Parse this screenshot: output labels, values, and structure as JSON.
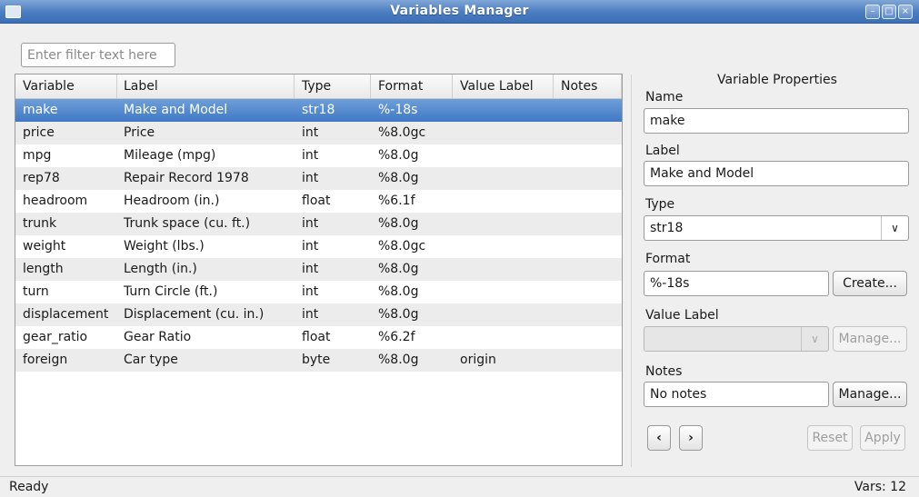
{
  "window": {
    "title": "Variables Manager",
    "buttons": {
      "minimize": "–",
      "maximize": "□",
      "close": "×"
    }
  },
  "filter": {
    "placeholder": "Enter filter text here",
    "value": ""
  },
  "table": {
    "headers": [
      "Variable",
      "Label",
      "Type",
      "Format",
      "Value Label",
      "Notes"
    ],
    "rows": [
      [
        "make",
        "Make and Model",
        "str18",
        "%-18s",
        "",
        ""
      ],
      [
        "price",
        "Price",
        "int",
        "%8.0gc",
        "",
        ""
      ],
      [
        "mpg",
        "Mileage (mpg)",
        "int",
        "%8.0g",
        "",
        ""
      ],
      [
        "rep78",
        "Repair Record 1978",
        "int",
        "%8.0g",
        "",
        ""
      ],
      [
        "headroom",
        "Headroom (in.)",
        "float",
        "%6.1f",
        "",
        ""
      ],
      [
        "trunk",
        "Trunk space (cu. ft.)",
        "int",
        "%8.0g",
        "",
        ""
      ],
      [
        "weight",
        "Weight (lbs.)",
        "int",
        "%8.0gc",
        "",
        ""
      ],
      [
        "length",
        "Length (in.)",
        "int",
        "%8.0g",
        "",
        ""
      ],
      [
        "turn",
        "Turn Circle (ft.)",
        "int",
        "%8.0g",
        "",
        ""
      ],
      [
        "displacement",
        "Displacement (cu. in.)",
        "int",
        "%8.0g",
        "",
        ""
      ],
      [
        "gear_ratio",
        "Gear Ratio",
        "float",
        "%6.2f",
        "",
        ""
      ],
      [
        "foreign",
        "Car type",
        "byte",
        "%8.0g",
        "origin",
        ""
      ]
    ],
    "selected_row": 0
  },
  "properties": {
    "title": "Variable Properties",
    "name_label": "Name",
    "name_value": "make",
    "label_label": "Label",
    "label_value": "Make and Model",
    "type_label": "Type",
    "type_value": "str18",
    "format_label": "Format",
    "format_value": "%-18s",
    "create_button": "Create...",
    "value_label_label": "Value Label",
    "value_label_value": "",
    "manage_value_label_button": "Manage...",
    "notes_label": "Notes",
    "notes_value": "No notes",
    "manage_notes_button": "Manage...",
    "prev_button": "‹",
    "next_button": "›",
    "reset_button": "Reset",
    "apply_button": "Apply"
  },
  "status": {
    "left": "Ready",
    "right": "Vars: 12"
  },
  "colors": {
    "titlebar": "#4a7cc0",
    "selection": "#4f84c9",
    "alt_row": "#ececec"
  }
}
